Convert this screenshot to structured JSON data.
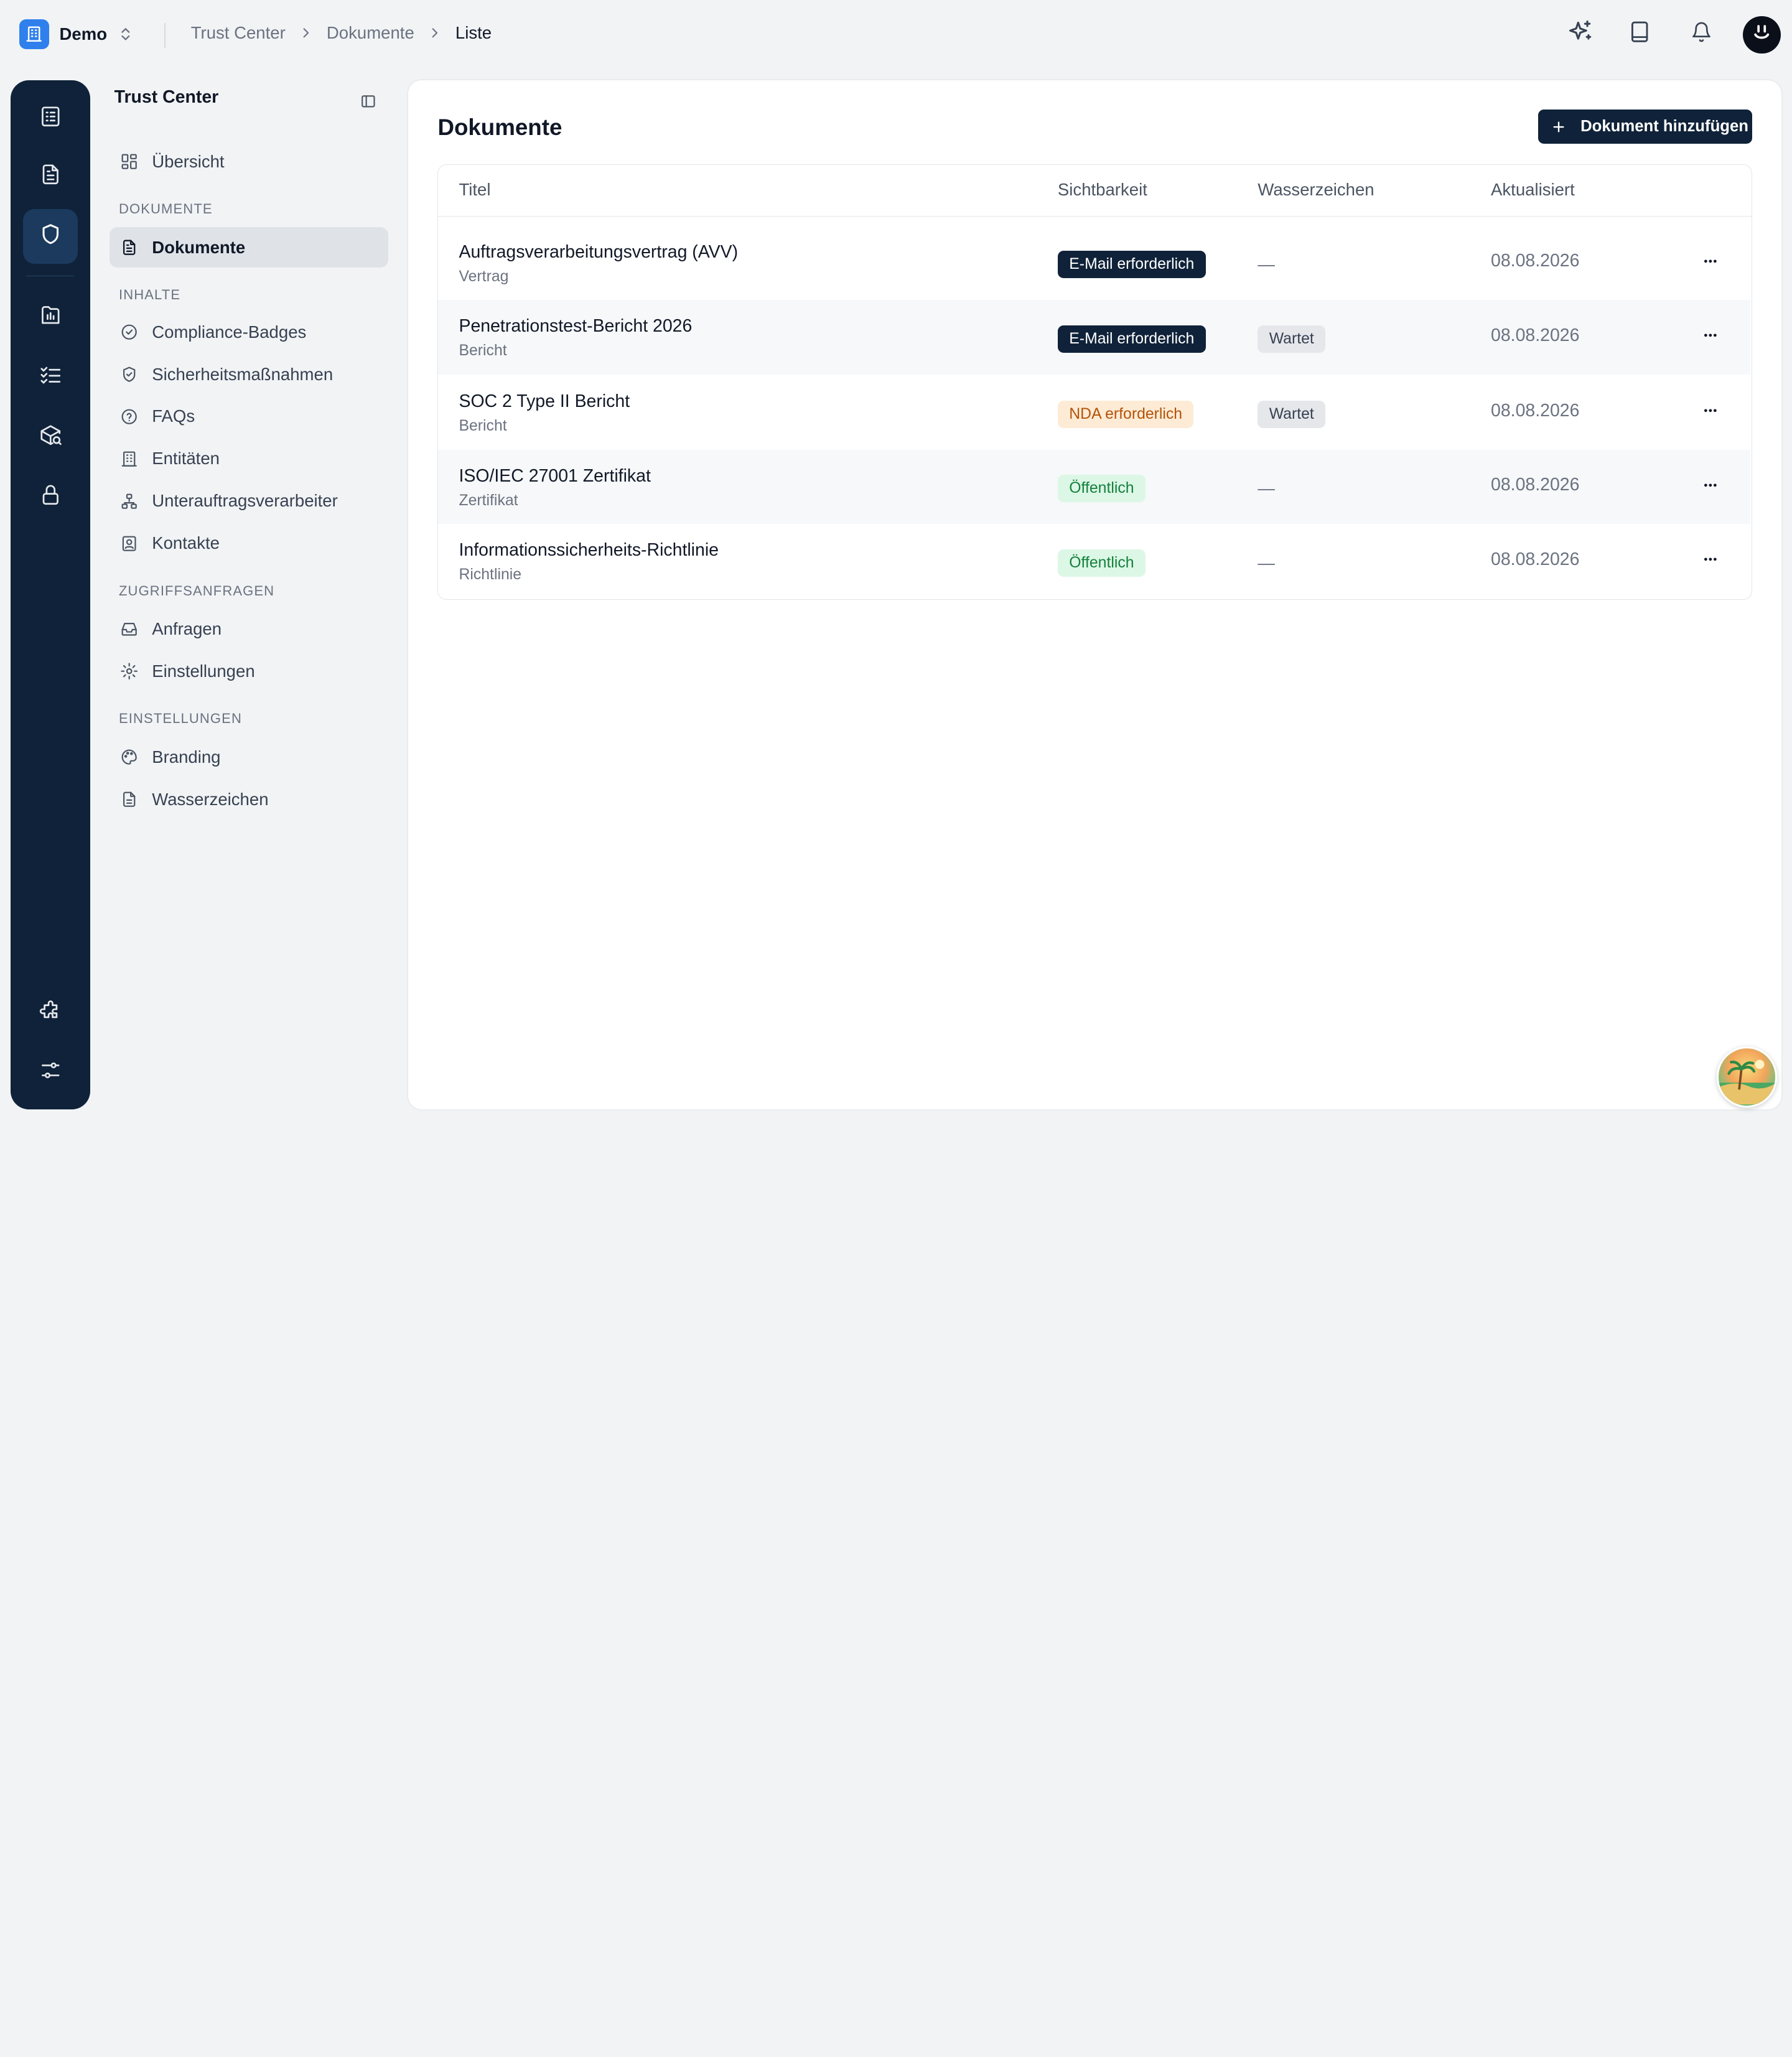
{
  "workspace": {
    "name": "Demo"
  },
  "breadcrumb": [
    "Trust Center",
    "Dokumente",
    "Liste"
  ],
  "sidebar": {
    "title": "Trust Center",
    "overview": "Übersicht",
    "sections": {
      "documents": "DOKUMENTE",
      "content": "INHALTE",
      "access": "ZUGRIFFSANFRAGEN",
      "settings": "EINSTELLUNGEN"
    },
    "items": {
      "documents": "Dokumente",
      "badges": "Compliance-Badges",
      "measures": "Sicherheitsmaßnahmen",
      "faqs": "FAQs",
      "entities": "Entitäten",
      "subprocessors": "Unterauftragsverarbeiter",
      "contacts": "Kontakte",
      "requests": "Anfragen",
      "access_settings": "Einstellungen",
      "branding": "Branding",
      "watermark": "Wasserzeichen"
    }
  },
  "main": {
    "title": "Dokumente",
    "add_button": "Dokument hinzufügen",
    "columns": [
      "Titel",
      "Sichtbarkeit",
      "Wasserzeichen",
      "Aktualisiert"
    ],
    "rows": [
      {
        "title": "Auftragsverarbeitungsvertrag (AVV)",
        "type": "Vertrag",
        "visibility": "E-Mail erforderlich",
        "watermark": "—",
        "updated": "08.08.2026"
      },
      {
        "title": "Penetrationstest-Bericht 2026",
        "type": "Bericht",
        "visibility": "E-Mail erforderlich",
        "watermark": "Wartet",
        "updated": "08.08.2026"
      },
      {
        "title": "SOC 2 Type II Bericht",
        "type": "Bericht",
        "visibility": "NDA erforderlich",
        "watermark": "Wartet",
        "updated": "08.08.2026"
      },
      {
        "title": "ISO/IEC 27001 Zertifikat",
        "type": "Zertifikat",
        "visibility": "Öffentlich",
        "watermark": "—",
        "updated": "08.08.2026"
      },
      {
        "title": "Informationssicherheits-Richtlinie",
        "type": "Richtlinie",
        "visibility": "Öffentlich",
        "watermark": "—",
        "updated": "08.08.2026"
      }
    ]
  },
  "colors": {
    "navy": "#0f2239",
    "accent_blue": "#2f80ed",
    "public_green": "#15803d",
    "nda_orange": "#b45309"
  },
  "icons": [
    "building-icon",
    "chevron-updown-icon",
    "chevron-right-icon",
    "sparkles-icon",
    "book-icon",
    "bell-icon",
    "smiley-avatar-icon",
    "task-list-icon",
    "document-icon",
    "shield-icon",
    "chart-icon",
    "checklist-icon",
    "package-search-icon",
    "lock-icon",
    "puzzle-icon",
    "sliders-icon",
    "sidebar-toggle-icon",
    "grid-icon",
    "badge-check-icon",
    "shield-check-icon",
    "help-circle-icon",
    "network-icon",
    "contact-icon",
    "inbox-icon",
    "gear-icon",
    "palette-icon",
    "plus-icon",
    "more-horizontal-icon"
  ]
}
